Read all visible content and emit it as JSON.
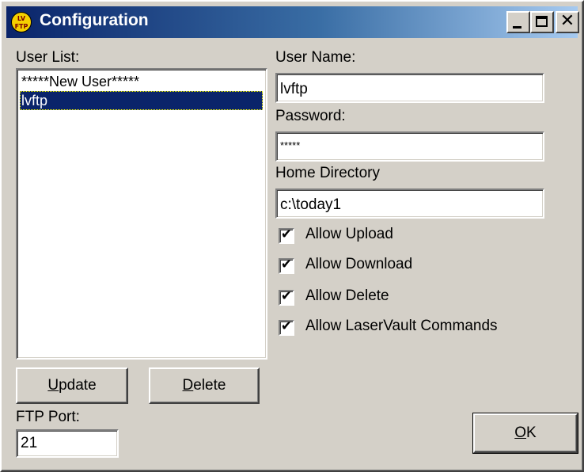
{
  "window": {
    "title": "Configuration",
    "icon_text_top": "LV",
    "icon_text_bottom": "FTP",
    "controls": {
      "minimize": "_",
      "maximize": "□",
      "close": "✕"
    }
  },
  "user_list": {
    "label": "User List:",
    "items": [
      {
        "label": "*****New User*****",
        "selected": false
      },
      {
        "label": "lvftp",
        "selected": true
      }
    ]
  },
  "buttons": {
    "update_mnemonic": "U",
    "update_rest": "pdate",
    "delete_mnemonic": "D",
    "delete_rest": "elete",
    "ok_mnemonic": "O",
    "ok_rest": "K"
  },
  "ftp_port": {
    "label": "FTP Port:",
    "value": "21"
  },
  "user_name": {
    "label": "User Name:",
    "value": "lvftp"
  },
  "password": {
    "label": "Password:",
    "value": "*****"
  },
  "home_directory": {
    "label": "Home Directory",
    "value": "c:\\today1"
  },
  "permissions": [
    {
      "label": "Allow Upload",
      "checked": true,
      "mark": "✔"
    },
    {
      "label": "Allow Download",
      "checked": true,
      "mark": "✔"
    },
    {
      "label": "Allow Delete",
      "checked": true,
      "mark": "✔"
    },
    {
      "label": "Allow LaserVault Commands",
      "checked": true,
      "mark": "✔"
    }
  ]
}
